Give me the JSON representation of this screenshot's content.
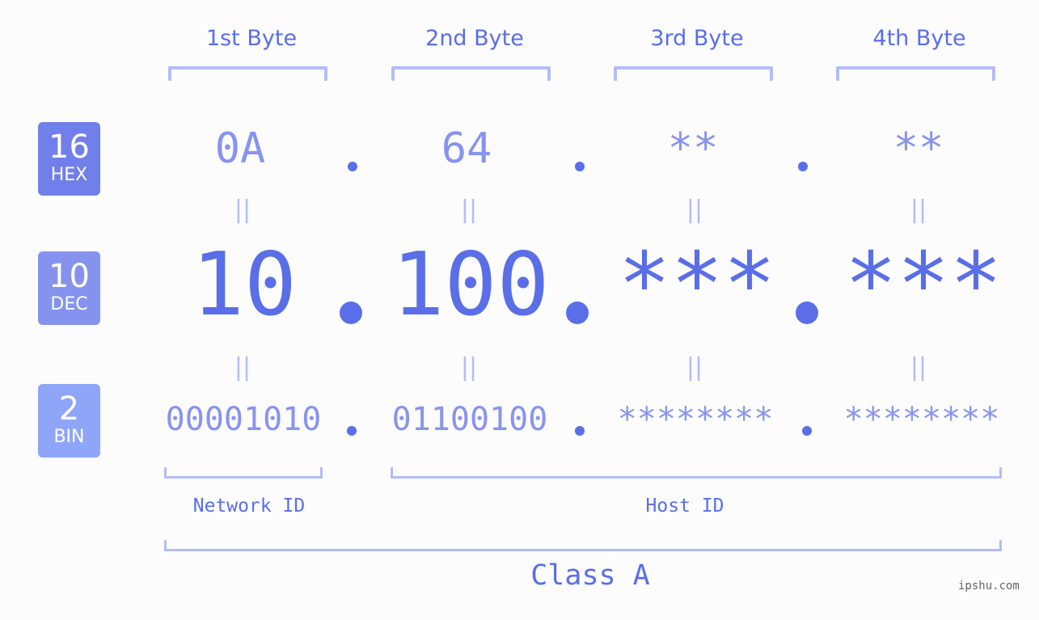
{
  "bytes": {
    "headers": [
      "1st Byte",
      "2nd Byte",
      "3rd Byte",
      "4th Byte"
    ]
  },
  "rows": {
    "hex": {
      "badge_number": "16",
      "badge_label": "HEX",
      "values": [
        "0A",
        "64",
        "**",
        "**"
      ]
    },
    "dec": {
      "badge_number": "10",
      "badge_label": "DEC",
      "values": [
        "10",
        "100",
        "***",
        "***"
      ]
    },
    "bin": {
      "badge_number": "2",
      "badge_label": "BIN",
      "values": [
        "00001010",
        "01100100",
        "********",
        "********"
      ]
    }
  },
  "separator": ".",
  "equals_glyph": "||",
  "segments": {
    "network_label": "Network ID",
    "host_label": "Host ID",
    "class_label": "Class A"
  },
  "watermark": "ipshu.com",
  "colors": {
    "hex_badge": "#717fea",
    "dec_badge": "#8593ee",
    "bin_badge": "#8fa5f7",
    "accent": "#5a6ee8",
    "muted_value": "#8893ef",
    "bracket": "#b4bcf8"
  }
}
